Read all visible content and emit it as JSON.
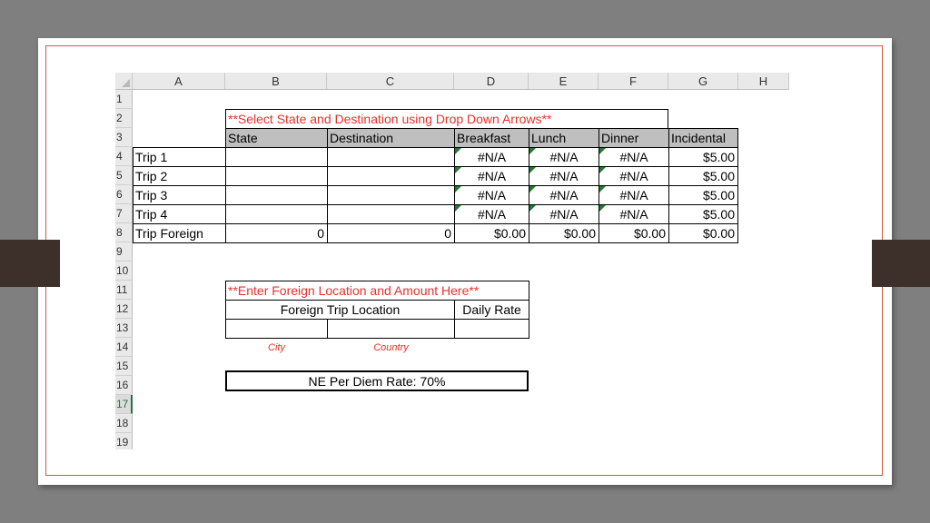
{
  "spreadsheet": {
    "columns": [
      "A",
      "B",
      "C",
      "D",
      "E",
      "F",
      "G",
      "H"
    ],
    "rows": [
      "1",
      "2",
      "3",
      "4",
      "5",
      "6",
      "7",
      "8",
      "9",
      "10",
      "11",
      "12",
      "13",
      "14",
      "15",
      "16",
      "17",
      "18",
      "19"
    ],
    "selected_row": "17",
    "title_note": "**Select State and Destination using Drop Down Arrows**",
    "headers": [
      "State",
      "Destination",
      "Breakfast",
      "Lunch",
      "Dinner",
      "Incidental"
    ],
    "trips": [
      {
        "label": "Trip 1",
        "state": "",
        "destination": "",
        "breakfast": "#N/A",
        "lunch": "#N/A",
        "dinner": "#N/A",
        "incidental": "$5.00"
      },
      {
        "label": "Trip 2",
        "state": "",
        "destination": "",
        "breakfast": "#N/A",
        "lunch": "#N/A",
        "dinner": "#N/A",
        "incidental": "$5.00"
      },
      {
        "label": "Trip 3",
        "state": "",
        "destination": "",
        "breakfast": "#N/A",
        "lunch": "#N/A",
        "dinner": "#N/A",
        "incidental": "$5.00"
      },
      {
        "label": "Trip 4",
        "state": "",
        "destination": "",
        "breakfast": "#N/A",
        "lunch": "#N/A",
        "dinner": "#N/A",
        "incidental": "$5.00"
      },
      {
        "label": "Trip Foreign",
        "state": "0",
        "destination": "0",
        "breakfast": "$0.00",
        "lunch": "$0.00",
        "dinner": "$0.00",
        "incidental": "$0.00"
      }
    ],
    "foreign_note": "**Enter Foreign Location and Amount Here**",
    "foreign_location_header": "Foreign Trip Location",
    "daily_rate_header": "Daily Rate",
    "city_label": "City",
    "country_label": "Country",
    "per_diem": "NE Per Diem Rate:  70%"
  },
  "colors": {
    "background": "#7f7f7f",
    "frame_accent": "#d35a3a",
    "side_tabs": "#3d302a",
    "header_fill": "#bfbfbf",
    "note_red": "#e8302a",
    "error_triangle": "#1e7b2f"
  }
}
